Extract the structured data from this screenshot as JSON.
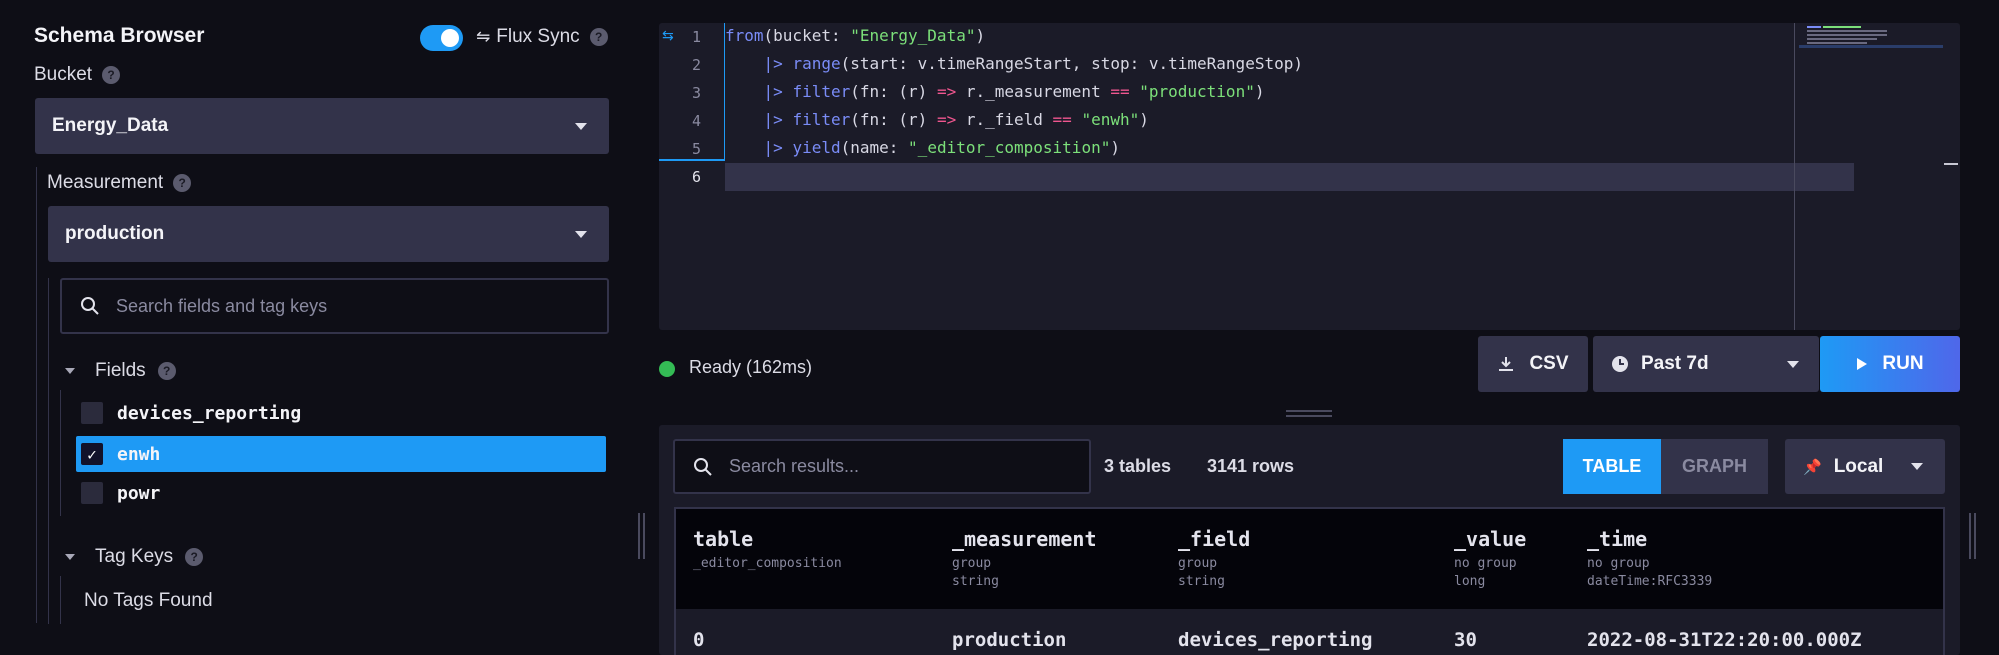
{
  "schema": {
    "title": "Schema Browser",
    "flux_sync_label": "Flux Sync",
    "flux_sync_on": true,
    "bucket_label": "Bucket",
    "bucket_value": "Energy_Data",
    "measurement_label": "Measurement",
    "measurement_value": "production",
    "search_placeholder": "Search fields and tag keys",
    "fields_label": "Fields",
    "fields": [
      {
        "name": "devices_reporting",
        "checked": false
      },
      {
        "name": "enwh",
        "checked": true
      },
      {
        "name": "powr",
        "checked": false
      }
    ],
    "tag_keys_label": "Tag Keys",
    "no_tags": "No Tags Found"
  },
  "editor": {
    "line_numbers": [
      "1",
      "2",
      "3",
      "4",
      "5",
      "6"
    ],
    "lines": [
      [
        {
          "t": "from",
          "c": "kw"
        },
        {
          "t": "(bucket: ",
          "c": ""
        },
        {
          "t": "\"Energy_Data\"",
          "c": "str"
        },
        {
          "t": ")",
          "c": ""
        }
      ],
      [
        {
          "t": "    ",
          "c": ""
        },
        {
          "t": "|>",
          "c": "pipe"
        },
        {
          "t": " ",
          "c": ""
        },
        {
          "t": "range",
          "c": "kw"
        },
        {
          "t": "(start: v.timeRangeStart, stop: v.timeRangeStop)",
          "c": ""
        }
      ],
      [
        {
          "t": "    ",
          "c": ""
        },
        {
          "t": "|>",
          "c": "pipe"
        },
        {
          "t": " ",
          "c": ""
        },
        {
          "t": "filter",
          "c": "kw"
        },
        {
          "t": "(fn: (r) ",
          "c": ""
        },
        {
          "t": "=>",
          "c": "op"
        },
        {
          "t": " r._measurement ",
          "c": ""
        },
        {
          "t": "==",
          "c": "op"
        },
        {
          "t": " ",
          "c": ""
        },
        {
          "t": "\"production\"",
          "c": "str"
        },
        {
          "t": ")",
          "c": ""
        }
      ],
      [
        {
          "t": "    ",
          "c": ""
        },
        {
          "t": "|>",
          "c": "pipe"
        },
        {
          "t": " ",
          "c": ""
        },
        {
          "t": "filter",
          "c": "kw"
        },
        {
          "t": "(fn: (r) ",
          "c": ""
        },
        {
          "t": "=>",
          "c": "op"
        },
        {
          "t": " r._field ",
          "c": ""
        },
        {
          "t": "==",
          "c": "op"
        },
        {
          "t": " ",
          "c": ""
        },
        {
          "t": "\"enwh\"",
          "c": "str"
        },
        {
          "t": ")",
          "c": ""
        }
      ],
      [
        {
          "t": "    ",
          "c": ""
        },
        {
          "t": "|>",
          "c": "pipe"
        },
        {
          "t": " ",
          "c": ""
        },
        {
          "t": "yield",
          "c": "kw"
        },
        {
          "t": "(name: ",
          "c": ""
        },
        {
          "t": "\"_editor_composition\"",
          "c": "str"
        },
        {
          "t": ")",
          "c": ""
        }
      ],
      []
    ]
  },
  "toolbar": {
    "status": "Ready (162ms)",
    "csv_label": "CSV",
    "time_range": "Past 7d",
    "run_label": "RUN"
  },
  "results": {
    "search_placeholder": "Search results...",
    "tables_count": "3 tables",
    "rows_count": "3141 rows",
    "view_table": "TABLE",
    "view_graph": "GRAPH",
    "timezone": "Local",
    "columns": [
      {
        "name": "table",
        "sub": "_editor_composition"
      },
      {
        "name": "_measurement",
        "sub": "group\nstring"
      },
      {
        "name": "_field",
        "sub": "group\nstring"
      },
      {
        "name": "_value",
        "sub": "no group\nlong"
      },
      {
        "name": "_time",
        "sub": "no group\ndateTime:RFC3339"
      }
    ],
    "first_row": [
      "0",
      "production",
      "devices_reporting",
      "30",
      "2022-08-31T22:20:00.000Z"
    ]
  },
  "colors": {
    "accent": "#1e9af5",
    "status_ok": "#34bb55",
    "background": "#0e0e16",
    "panel": "#1b1b28"
  }
}
